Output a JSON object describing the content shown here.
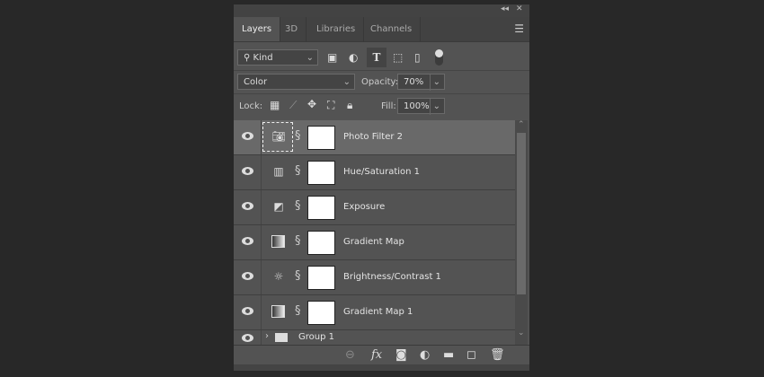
{
  "panel": {
    "collapse_icon": "double-chevron-left",
    "close_icon": "close"
  },
  "tabs": [
    {
      "label": "Layers",
      "active": true
    },
    {
      "label": "3D"
    },
    {
      "label": "Libraries"
    },
    {
      "label": "Channels"
    }
  ],
  "filter": {
    "kind_label": "Kind"
  },
  "blend": {
    "mode": "Color",
    "opacity_label": "Opacity:",
    "opacity": "70%"
  },
  "lock": {
    "label": "Lock:",
    "fill_label": "Fill:",
    "fill": "100%"
  },
  "layers": [
    {
      "name": "Photo Filter 2",
      "icon": "camera",
      "selected": true
    },
    {
      "name": "Hue/Saturation 1",
      "icon": "hue-saturation"
    },
    {
      "name": "Exposure",
      "icon": "exposure"
    },
    {
      "name": "Gradient Map",
      "icon": "gradient-map"
    },
    {
      "name": "Brightness/Contrast 1",
      "icon": "brightness"
    },
    {
      "name": "Gradient Map 1",
      "icon": "gradient-map"
    },
    {
      "name": "Group 1",
      "icon": "folder"
    }
  ]
}
